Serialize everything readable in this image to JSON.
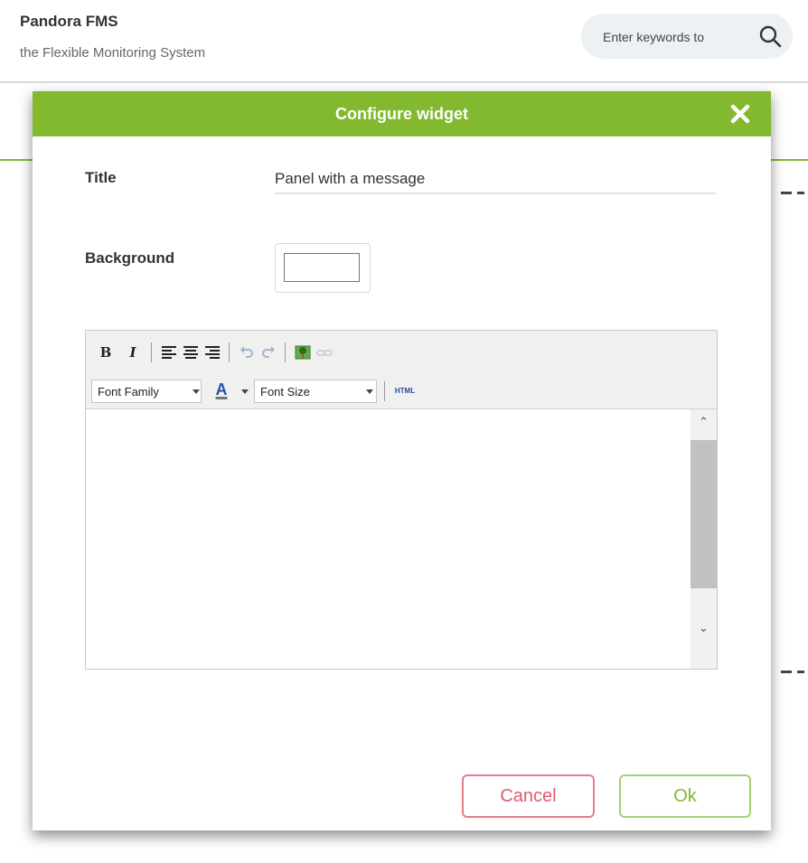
{
  "header": {
    "app_title": "Pandora FMS",
    "subtitle": "the Flexible Monitoring System",
    "search_placeholder": "Enter keywords to"
  },
  "colors": {
    "accent": "#82b92e",
    "cancel": "#e05a6e"
  },
  "modal": {
    "title": "Configure widget",
    "fields": {
      "title_label": "Title",
      "title_value": "Panel with a message",
      "background_label": "Background",
      "background_color": "#ffffff"
    },
    "editor": {
      "toolbar": {
        "bold": "B",
        "italic": "I",
        "font_family": "Font Family",
        "font_color_glyph": "A",
        "font_size": "Font Size",
        "html": "HTML"
      },
      "content": ""
    },
    "buttons": {
      "cancel": "Cancel",
      "ok": "Ok"
    }
  }
}
